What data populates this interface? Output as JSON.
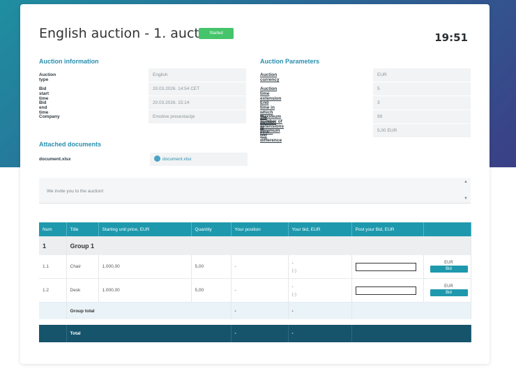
{
  "header": {
    "title": "English auction - 1. auction",
    "status": "Started",
    "clock": "19:51"
  },
  "auction_info": {
    "heading": "Auction information",
    "rows": [
      {
        "key": "Auction type",
        "value": "English"
      },
      {
        "key": "Bid start time",
        "value": "20.03.2026. 14:54 CET"
      },
      {
        "key": "Bid end time",
        "value": "20.03.2026. 15:14"
      },
      {
        "key": "Company",
        "value": "Emotive presentacije"
      }
    ]
  },
  "auction_params": {
    "heading": "Auction Parameters",
    "rows": [
      {
        "key": "Auction currency",
        "value": "EUR"
      },
      {
        "key": "Auction time extension",
        "value": "5"
      },
      {
        "key": "End time in which the auction is exte...",
        "value": "3"
      },
      {
        "key": "Maximum number of extensions",
        "value": "99"
      },
      {
        "key": "Minimum bid difference",
        "value": "5,00 EUR"
      }
    ]
  },
  "documents": {
    "heading": "Attached documents",
    "label": "document.xlsx",
    "file": "document.xlsx"
  },
  "message": "We invite you to the auction!",
  "table": {
    "headers": [
      "Num",
      "Title",
      "Starting unit price, EUR",
      "Quantity",
      "Your position",
      "Your bid, EUR",
      "Post your Bid, EUR"
    ],
    "group": {
      "num": "1",
      "title": "Group 1"
    },
    "items": [
      {
        "num": "1.1",
        "title": "Chair",
        "price": "1.000,00",
        "qty": "5,00",
        "position": "-",
        "bid": "-",
        "bid_sub": "(-)",
        "currency": "EUR",
        "button": "Bid"
      },
      {
        "num": "1.2",
        "title": "Desk",
        "price": "1.000,00",
        "qty": "5,00",
        "position": "-",
        "bid": "-",
        "bid_sub": "(-)",
        "currency": "EUR",
        "button": "Bid"
      }
    ],
    "group_total": {
      "label": "Group total",
      "position": "-",
      "bid": "-"
    },
    "total": {
      "label": "Total",
      "position": "-",
      "bid": "-"
    }
  },
  "colors": {
    "accent": "#1e98ad",
    "status": "#46c46b",
    "total_row": "#16546b"
  }
}
